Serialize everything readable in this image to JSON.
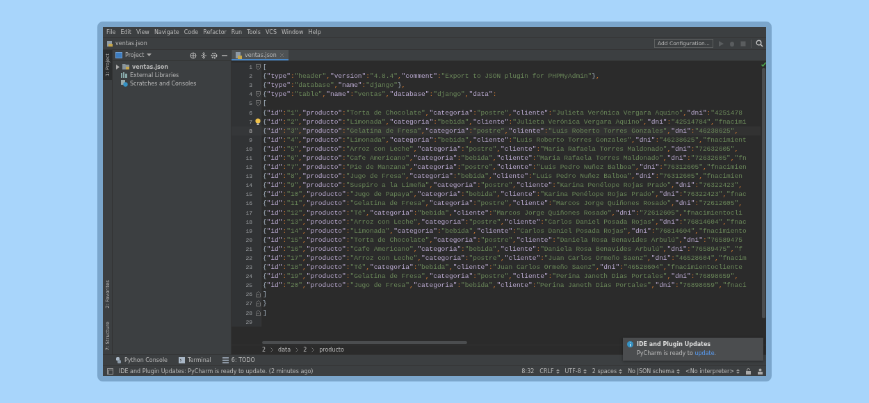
{
  "menu": [
    "File",
    "Edit",
    "View",
    "Navigate",
    "Code",
    "Refactor",
    "Run",
    "Tools",
    "VCS",
    "Window",
    "Help"
  ],
  "navbar": {
    "file": "ventas.json",
    "config_button": "Add Configuration..."
  },
  "tool_strip": {
    "top": [
      {
        "label": "1: Project",
        "selected": true
      }
    ],
    "bottom": [
      {
        "label": "2: Favorites",
        "selected": false
      },
      {
        "label": "7: Structure",
        "selected": false
      }
    ]
  },
  "project": {
    "title": "Project",
    "items": [
      {
        "label": "ventas.json",
        "kind": "folder",
        "bold": true,
        "expanded": false
      },
      {
        "label": "External Libraries",
        "kind": "libraries",
        "bold": false
      },
      {
        "label": "Scratches and Consoles",
        "kind": "scratches",
        "bold": false
      }
    ]
  },
  "tabs": [
    {
      "label": "ventas.json",
      "selected": true
    }
  ],
  "lines": [
    {
      "n": "1",
      "text": "[",
      "kind": "fold_start",
      "current": false,
      "bulb": false
    },
    {
      "n": "2",
      "text": "{\"type\":\"header\",\"version\":\"4.8.4\",\"comment\":\"Export to JSON plugin for PHPMyAdmin\"},",
      "current": false,
      "bulb": false
    },
    {
      "n": "3",
      "text": "{\"type\":\"database\",\"name\":\"django\"},",
      "current": false,
      "bulb": false
    },
    {
      "n": "4",
      "text": "{\"type\":\"table\",\"name\":\"ventas\",\"database\":\"django\",\"data\":",
      "kind": "fold_start",
      "current": false,
      "bulb": false
    },
    {
      "n": "5",
      "text": "[",
      "kind": "fold_start",
      "current": false,
      "bulb": false
    },
    {
      "n": "6",
      "text": "{\"id\":\"1\",\"producto\":\"Torta de Chocolate\",\"categoria\":\"postre\",\"cliente\":\"Julieta Verónica Vergara Aquino\",\"dni\":\"4251478",
      "current": false,
      "bulb": false
    },
    {
      "n": "7",
      "text": "{\"id\":\"2\",\"producto\":\"Limonada\",\"categoria\":\"bebida\",\"cliente\":\"Julieta Verónica Vergara Aquino\",\"dni\":\"42514784\",\"fnacimi",
      "current": false,
      "bulb": true
    },
    {
      "n": "8",
      "text": "{\"id\":\"3\",\"producto\":\"Gelatina de Fresa\",\"categoria\":\"postre\",\"cliente\":\"Luis Roberto Torres Gonzales\",\"dni\":\"46238625\",",
      "current": true,
      "bulb": false
    },
    {
      "n": "9",
      "text": "{\"id\":\"4\",\"producto\":\"Limonada\",\"categoria\":\"bebida\",\"cliente\":\"Luis Roberto Torres Gonzales\",\"dni\":\"46238625\",\"fnacimient",
      "current": false,
      "bulb": false
    },
    {
      "n": "10",
      "text": "{\"id\":\"5\",\"producto\":\"Arroz con Leche\",\"categoria\":\"postre\",\"cliente\":\"Maria Rafaela Torres Maldonado\",\"dni\":\"72632605\",",
      "current": false,
      "bulb": false
    },
    {
      "n": "11",
      "text": "{\"id\":\"6\",\"producto\":\"Cafe Americano\",\"categoria\":\"bebida\",\"cliente\":\"Maria Rafaela Torres Maldonado\",\"dni\":\"72632605\",\"fn",
      "current": false,
      "bulb": false
    },
    {
      "n": "12",
      "text": "{\"id\":\"7\",\"producto\":\"Pie de Manzana\",\"categoria\":\"postre\",\"cliente\":\"Luis Pedro Nuñez Balboa\",\"dni\":\"76312605\",\"fnacimien",
      "current": false,
      "bulb": false
    },
    {
      "n": "13",
      "text": "{\"id\":\"8\",\"producto\":\"Jugo de Fresa\",\"categoria\":\"bebida\",\"cliente\":\"Luis Pedro Nuñez Balboa\",\"dni\":\"76312605\",\"fnacimien",
      "current": false,
      "bulb": false
    },
    {
      "n": "14",
      "text": "{\"id\":\"9\",\"producto\":\"Suspiro a la Limeña\",\"categoria\":\"postre\",\"cliente\":\"Karina Penélope Rojas Prado\",\"dni\":\"76322423\",",
      "current": false,
      "bulb": false
    },
    {
      "n": "15",
      "text": "{\"id\":\"10\",\"producto\":\"Jugo de Papaya\",\"categoria\":\"bebida\",\"cliente\":\"Karina Penélope Rojas Prado\",\"dni\":\"76322423\",\"fnac",
      "current": false,
      "bulb": false
    },
    {
      "n": "16",
      "text": "{\"id\":\"11\",\"producto\":\"Gelatina de Fresa\",\"categoria\":\"postre\",\"cliente\":\"Marcos Jorge Quiñones Rosado\",\"dni\":\"72612605\",",
      "current": false,
      "bulb": false
    },
    {
      "n": "17",
      "text": "{\"id\":\"12\",\"producto\":\"Té\",\"categoria\":\"bebida\",\"cliente\":\"Marcos Jorge Quiñones Rosado\",\"dni\":\"72612605\",\"fnacimientocli",
      "current": false,
      "bulb": false
    },
    {
      "n": "18",
      "text": "{\"id\":\"13\",\"producto\":\"Arroz con Leche\",\"categoria\":\"postre\",\"cliente\":\"Carlos Daniel Posada Rojas\",\"dni\":\"76814604\",\"fnac",
      "current": false,
      "bulb": false
    },
    {
      "n": "19",
      "text": "{\"id\":\"14\",\"producto\":\"Limonada\",\"categoria\":\"bebida\",\"cliente\":\"Carlos Daniel Posada Rojas\",\"dni\":\"76814604\",\"fnacimiento",
      "current": false,
      "bulb": false
    },
    {
      "n": "20",
      "text": "{\"id\":\"15\",\"producto\":\"Torta de Chocolate\",\"categoria\":\"postre\",\"cliente\":\"Daniela Rosa Benavides Arbulú\",\"dni\":\"76589475",
      "current": false,
      "bulb": false
    },
    {
      "n": "21",
      "text": "{\"id\":\"16\",\"producto\":\"Cafe Americano\",\"categoria\":\"bebida\",\"cliente\":\"Daniela Rosa Benavides Arbulú\",\"dni\":\"76589475\",\"f",
      "current": false,
      "bulb": false
    },
    {
      "n": "22",
      "text": "{\"id\":\"17\",\"producto\":\"Arroz con Leche\",\"categoria\":\"postre\",\"cliente\":\"Juan Carlos Ormeño Saenz\",\"dni\":\"46528604\",\"fnacim",
      "current": false,
      "bulb": false
    },
    {
      "n": "23",
      "text": "{\"id\":\"18\",\"producto\":\"Té\",\"categoria\":\"bebida\",\"cliente\":\"Juan Carlos Ormeño Saenz\",\"dni\":\"46528604\",\"fnacimientocliente",
      "current": false,
      "bulb": false
    },
    {
      "n": "24",
      "text": "{\"id\":\"19\",\"producto\":\"Gelatina de Fresa\",\"categoria\":\"postre\",\"cliente\":\"Perina Janeth Dias Portales\",\"dni\":\"76898659\",",
      "current": false,
      "bulb": false
    },
    {
      "n": "25",
      "text": "{\"id\":\"20\",\"producto\":\"Jugo de Fresa\",\"categoria\":\"bebida\",\"cliente\":\"Perina Janeth Dias Portales\",\"dni\":\"76898659\",\"fnaci",
      "current": false,
      "bulb": false
    },
    {
      "n": "26",
      "text": "]",
      "kind": "fold_end",
      "current": false,
      "bulb": false
    },
    {
      "n": "27",
      "text": "}",
      "kind": "fold_end",
      "current": false,
      "bulb": false
    },
    {
      "n": "28",
      "text": "]",
      "kind": "fold_end",
      "current": false,
      "bulb": false
    },
    {
      "n": "29",
      "current": false,
      "bulb": false
    }
  ],
  "breadcrumbs": [
    "2",
    "data",
    "2",
    "producto"
  ],
  "bottom_tools": [
    {
      "label": "Python Console",
      "kind": "python"
    },
    {
      "label": "Terminal",
      "kind": "terminal"
    },
    {
      "label": "6: TODO",
      "kind": "todo"
    }
  ],
  "notification": {
    "title": "IDE and Plugin Updates",
    "text": "PyCharm is ready to ",
    "link": "update",
    "end": "."
  },
  "status_bar": {
    "message": "IDE and Plugin Updates: PyCharm is ready to update. (2 minutes ago)",
    "items": [
      {
        "text": "8:32",
        "dropdown": false
      },
      {
        "text": "CRLF",
        "dropdown": true
      },
      {
        "text": "UTF-8",
        "dropdown": true
      },
      {
        "text": "2 spaces",
        "dropdown": true
      },
      {
        "text": "No JSON schema",
        "dropdown": true
      },
      {
        "text": "<No interpreter>",
        "dropdown": true
      }
    ]
  }
}
